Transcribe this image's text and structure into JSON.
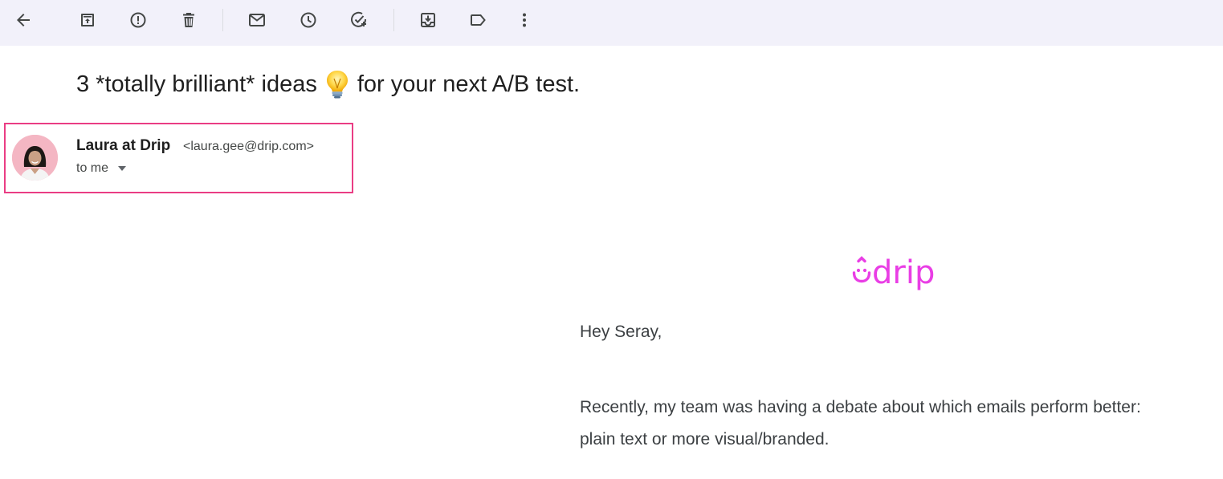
{
  "toolbar": {
    "buttons": [
      {
        "name": "back",
        "icon": "arrow-left-icon"
      },
      {
        "name": "archive",
        "icon": "archive-icon"
      },
      {
        "name": "report-spam",
        "icon": "report-spam-icon"
      },
      {
        "name": "delete",
        "icon": "trash-icon"
      },
      {
        "name": "mark-unread",
        "icon": "mail-icon"
      },
      {
        "name": "snooze",
        "icon": "clock-icon"
      },
      {
        "name": "add-to-tasks",
        "icon": "add-task-icon"
      },
      {
        "name": "move-to",
        "icon": "move-to-inbox-icon"
      },
      {
        "name": "labels",
        "icon": "label-icon"
      },
      {
        "name": "more",
        "icon": "more-vert-icon"
      }
    ]
  },
  "email": {
    "subject_before": "3 *totally brilliant* ideas",
    "subject_after": "for your next A/B test.",
    "sender_name": "Laura at Drip",
    "sender_email": "<laura.gee@drip.com>",
    "recipient_label": "to me",
    "logo_text": "drip",
    "greeting": "Hey Seray,",
    "paragraph_line1": "Recently, my team was having a debate about which emails perform better:",
    "paragraph_line2": "plain text or more visual/branded."
  },
  "colors": {
    "toolbar_bg": "#f2f1fa",
    "highlight_border": "#ea3d84",
    "brand": "#e93ee5"
  }
}
